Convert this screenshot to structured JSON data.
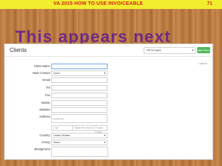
{
  "slide": {
    "header_left": "VA 2015     HOW TO USE INVOICEABLE",
    "page_number": "71",
    "headline": "This appears next"
  },
  "panel": {
    "title": "Clients",
    "group_filter": "All Groups",
    "add_button": "Add Client",
    "cancel": "Cancel"
  },
  "form": {
    "client_name": {
      "label": "Client Name:",
      "value": ""
    },
    "main_contact": {
      "label": "Main Contact:",
      "value": "None"
    },
    "email": {
      "label": "Email:",
      "value": ""
    },
    "tel": {
      "label": "Tel:",
      "value": ""
    },
    "fax": {
      "label": "Fax:",
      "value": ""
    },
    "mobile": {
      "label": "Mobile:",
      "value": ""
    },
    "website": {
      "label": "Website:",
      "value": ""
    },
    "address": {
      "label": "Address:",
      "placeholder": "Address"
    },
    "city": {
      "placeholder": "City"
    },
    "state": {
      "placeholder": "State/Province"
    },
    "postal": {
      "placeholder": "Postal Code"
    },
    "country": {
      "label": "Country:",
      "value": "United States"
    },
    "group": {
      "label": "Group:",
      "value": "None"
    },
    "background": {
      "label": "Background:"
    }
  }
}
